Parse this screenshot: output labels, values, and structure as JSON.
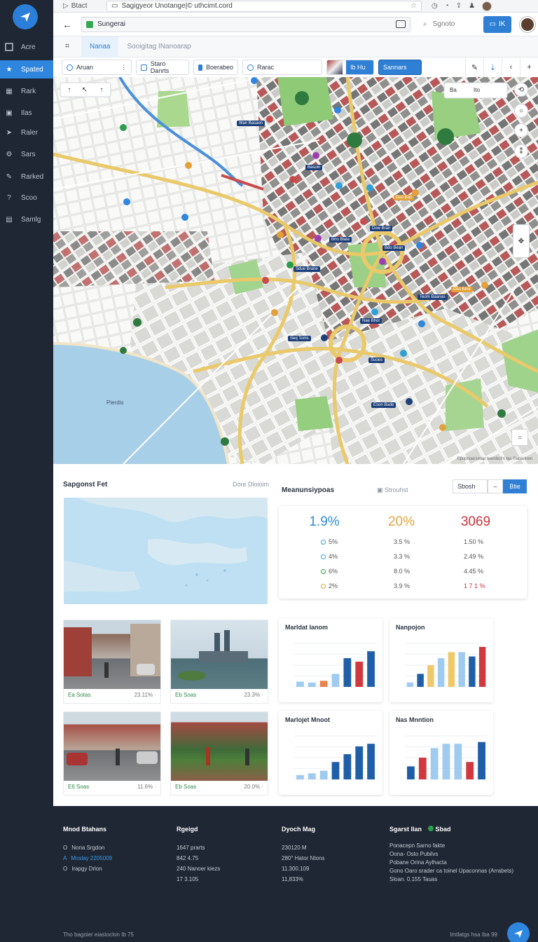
{
  "sidebar": {
    "items": [
      {
        "label": "Acre",
        "icon": "inbox-icon"
      },
      {
        "label": "Spated",
        "icon": "star-icon",
        "active": true
      },
      {
        "label": "Rark",
        "icon": "grid-icon"
      },
      {
        "label": "Ilas",
        "icon": "image-icon"
      },
      {
        "label": "Raler",
        "icon": "tag-icon"
      },
      {
        "label": "Sars",
        "icon": "gear-icon"
      },
      {
        "label": "Rarked",
        "icon": "pin-icon"
      },
      {
        "label": "Scoo",
        "icon": "help-icon"
      },
      {
        "label": "Samlg",
        "icon": "file-icon"
      }
    ]
  },
  "browser": {
    "back_label": "Btact",
    "url": "Sagigyeor Unotange|© uthcimt.cord"
  },
  "toolbar": {
    "search_value": "Sungerai",
    "find_label": "Sgnoto",
    "action_label": "IK"
  },
  "tabs": [
    {
      "label": "Nanaa",
      "active": true
    },
    {
      "label": "Sooigitag INanoarap",
      "active": false
    }
  ],
  "filters": [
    {
      "label": "Aruan"
    },
    {
      "label": "Staro Danrts"
    },
    {
      "label": "Boerabeo"
    },
    {
      "label": "Rarac"
    },
    {
      "label": "Ib Hu"
    },
    {
      "label": "Sannars"
    }
  ],
  "map": {
    "place_label": "Pierdis",
    "filter_label": "Ba",
    "filter_label2": "Ito",
    "pills": [
      "Wan Basaen",
      "Basoin",
      "Duo Ban",
      "Dow Bran",
      "Bno Blate",
      "Bdo Bean",
      "Sdue Brane",
      "Oso Bine",
      "Teom Baanas",
      "Nae Bhor",
      "Seq Toms",
      "Suoes",
      "Eson Bade"
    ],
    "attribution": "©popnoarsmap teeinbcfrs tas ©abaonen"
  },
  "sections": {
    "left_title": "Sapgonst Fet",
    "left_sub": "Dore Dloioim",
    "right_title": "Meanunsiypoas",
    "right_sub": "Strouhst",
    "seg_input": "Sbosh",
    "seg_minus": "–",
    "seg_btn": "Btie"
  },
  "stats": {
    "big": [
      "1.9%",
      "20%",
      "3069"
    ],
    "big_colors": [
      "#2f8fd0",
      "#e0a640",
      "#c9343f"
    ],
    "rows": [
      [
        "5%",
        "3.5 %",
        "1.50 %"
      ],
      [
        "4%",
        "3.3 %",
        "2.49 %"
      ],
      [
        "6%",
        "8.0 %",
        "4.45 %"
      ],
      [
        "2%",
        "3.9 %",
        "1 7 1 %"
      ]
    ]
  },
  "photos": [
    {
      "left": "Ea Sotas",
      "right": "23.11% ·"
    },
    {
      "left": "Eb Soas",
      "right": "23.3% ·"
    },
    {
      "left": "E6 Soas",
      "right": "11.6% ·"
    },
    {
      "left": "Eb Soas",
      "right": "20.0% ·"
    }
  ],
  "charts": [
    {
      "title": "Marldat Ianom"
    },
    {
      "title": "Nanpojon"
    },
    {
      "title": "Marlojet Mnoot"
    },
    {
      "title": "Nas Mnntion"
    }
  ],
  "footer": {
    "col1_title": "Mnod Btahans",
    "col1_items": [
      "Nona Srgdon",
      "Moslay 2205009",
      "Irapgy Drlon"
    ],
    "col1_prefix": [
      "O",
      "A",
      "O"
    ],
    "col2_title": "Rgeigd",
    "col2_items": [
      "1647 prarts",
      "842 4.75",
      "240 Nanoer kiezs",
      "17 3.105"
    ],
    "col3_title": "Dyoch Mag",
    "col3_items": [
      "230120 M",
      "280° Hator Ntons",
      "11.300.109",
      "11,833%"
    ],
    "col4_title": "Sgarst Ilan",
    "col4_badge": "Sbad",
    "col4_items": [
      "Ponacepn Sarno fakte",
      "Oona-  Osto  Pubilvs",
      "Pobane Orina Aylhacta",
      "Gono Oaro srader ca toinel Upaconnas (Arrabets)",
      "Sloan. 0.155 Tauas"
    ],
    "copyright": "Tho bagoier eiastoclon Ib 75",
    "right_text": "Imtlatgs hsa Iba 99"
  }
}
